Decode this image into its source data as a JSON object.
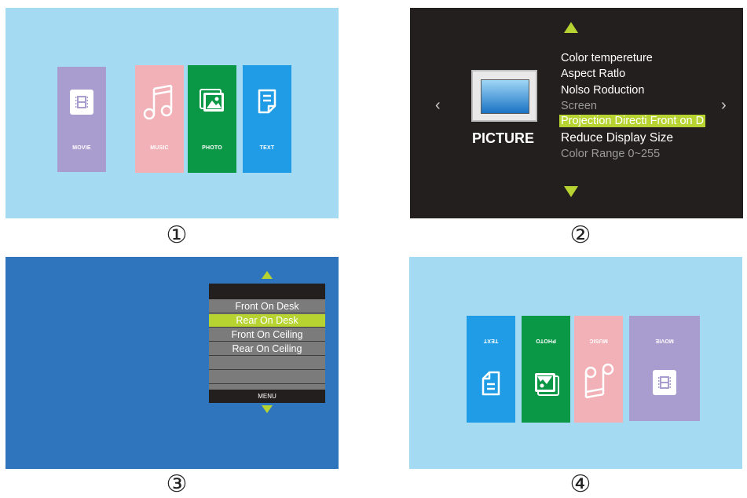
{
  "panel1": {
    "number": "①",
    "tiles": [
      {
        "label": "MOVIE",
        "icon": "film-icon",
        "color": "#a99cce"
      },
      {
        "label": "MUSIC",
        "icon": "music-note-icon",
        "color": "#f2b1b6"
      },
      {
        "label": "PHOTO",
        "icon": "photo-icon",
        "color": "#0a9847"
      },
      {
        "label": "TEXT",
        "icon": "document-icon",
        "color": "#1f9ce5"
      }
    ],
    "background": "#a5daf3"
  },
  "panel2": {
    "number": "②",
    "title": "PICTURE",
    "items": [
      "Color tempereture",
      "Aspect Ratlo",
      "Nolso Roduction",
      "Screen",
      "Projection Directi  Front on D",
      "Reduce  Display Size",
      "Color Range 0~255"
    ],
    "selected_index": 4,
    "left_arrow": "‹",
    "right_arrow": "›",
    "accent": "#b6d332",
    "background": "#231f1e"
  },
  "panel3": {
    "number": "③",
    "options": [
      "Front On Desk",
      "Rear On Desk",
      "Front On Ceiling",
      "Rear On Ceiling",
      "",
      "",
      ""
    ],
    "selected_index": 1,
    "footer": "MENU",
    "background": "#2f75bd"
  },
  "panel4": {
    "number": "④",
    "tiles": [
      {
        "label": "TEXT",
        "icon": "document-icon",
        "color": "#1f9ce5"
      },
      {
        "label": "PHOTO",
        "icon": "photo-icon",
        "color": "#0a9847"
      },
      {
        "label": "MUSIC",
        "icon": "music-note-icon",
        "color": "#f2b1b6"
      },
      {
        "label": "MOVIE",
        "icon": "film-icon",
        "color": "#a99cce"
      }
    ],
    "background": "#a5daf3"
  }
}
